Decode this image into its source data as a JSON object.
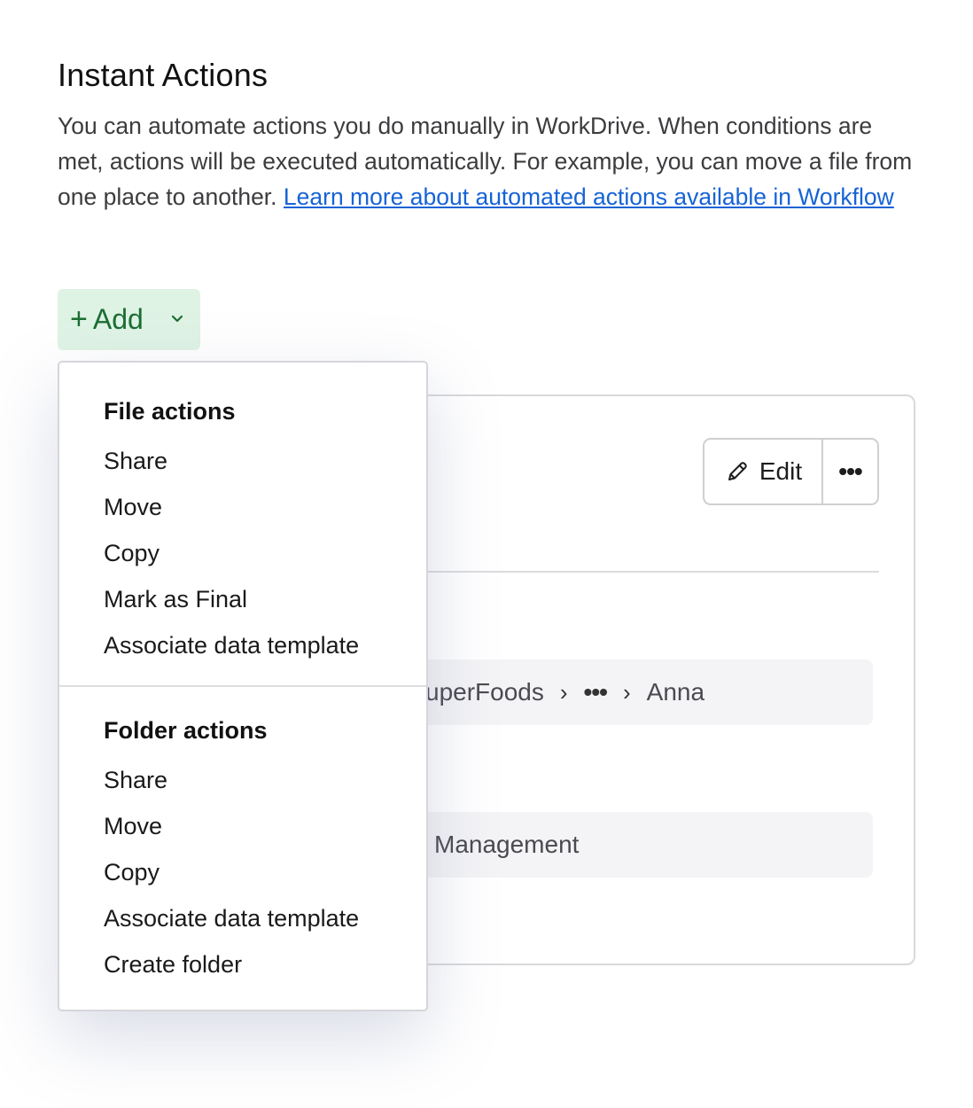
{
  "header": {
    "title": "Instant Actions",
    "description": "You can automate actions you do manually in WorkDrive. When conditions are met, actions will be executed automatically. For example, you can move a file from one place to another. ",
    "learn_more_link": "Learn more about automated actions available in Workflow"
  },
  "add_button": {
    "plus": "+",
    "label": "Add"
  },
  "card": {
    "edit_label": "Edit",
    "more_label": "•••",
    "path": {
      "segment1": "uperFoods",
      "ellipsis": "•••",
      "segment2": "Anna",
      "separator": "›"
    },
    "management_text": "Management"
  },
  "menu": {
    "file_section": {
      "heading": "File actions",
      "items": [
        "Share",
        "Move",
        "Copy",
        "Mark as Final",
        "Associate data template"
      ]
    },
    "folder_section": {
      "heading": "Folder actions",
      "items": [
        "Share",
        "Move",
        "Copy",
        "Associate data template",
        "Create folder"
      ]
    }
  }
}
